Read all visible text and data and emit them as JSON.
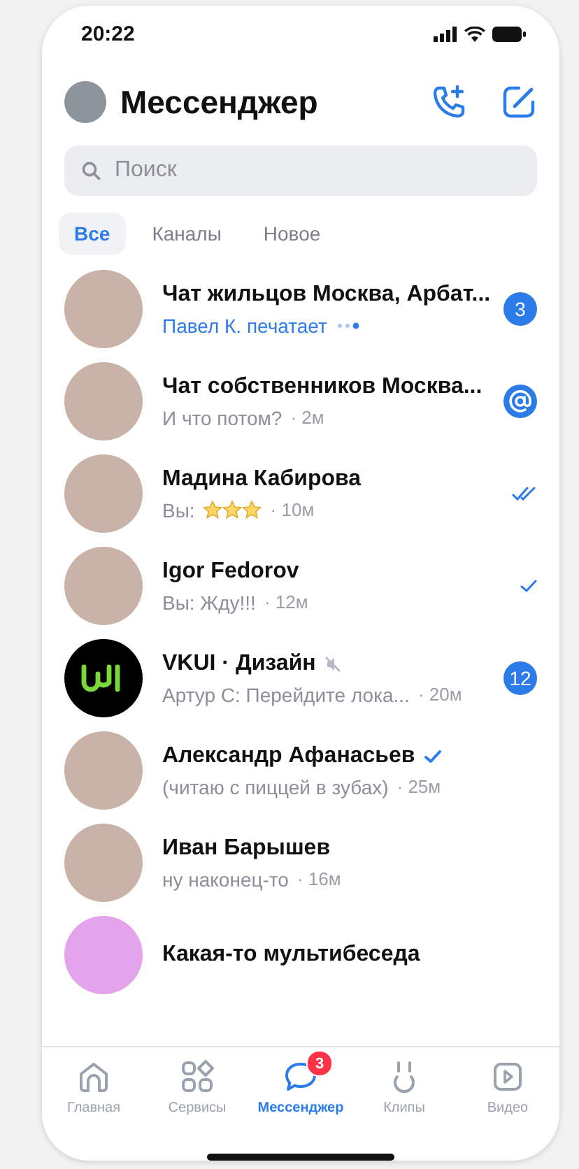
{
  "status_bar": {
    "time": "20:22"
  },
  "header": {
    "title": "Мессенджер"
  },
  "search": {
    "placeholder": "Поиск"
  },
  "filters": [
    {
      "label": "Все",
      "selected": true
    },
    {
      "label": "Каналы",
      "selected": false
    },
    {
      "label": "Новое",
      "selected": false
    }
  ],
  "chats": [
    {
      "avatar": {
        "kind": "photo"
      },
      "title": "Чат жильцов Москва, Арбат...",
      "message": "Павел К. печатает",
      "typing": true,
      "indicator": {
        "kind": "count",
        "unread": "3"
      }
    },
    {
      "avatar": {
        "kind": "photo"
      },
      "title": "Чат собственников Москва...",
      "message": "И что потом?",
      "time": "· 2м",
      "typing": false,
      "indicator": {
        "kind": "mention"
      }
    },
    {
      "avatar": {
        "kind": "photo"
      },
      "title": "Мадина Кабирова",
      "message": "Вы:",
      "stars": 3,
      "time": "· 10м",
      "typing": false,
      "indicator": {
        "kind": "read"
      }
    },
    {
      "avatar": {
        "kind": "photo"
      },
      "title": "Igor Fedorov",
      "message": "Вы: Жду!!!",
      "time": "· 12м",
      "typing": false,
      "indicator": {
        "kind": "sent"
      }
    },
    {
      "avatar": {
        "kind": "logo"
      },
      "title": "VKUI · Дизайн",
      "muted": true,
      "message": "Артур С: Перейдите лока...",
      "time": "· 20м",
      "typing": false,
      "indicator": {
        "kind": "count",
        "unread": "12"
      }
    },
    {
      "avatar": {
        "kind": "photo"
      },
      "title": "Александр Афанасьев",
      "verified": true,
      "message": "(читаю с пиццей в зубах)",
      "time": "· 25м",
      "typing": false
    },
    {
      "avatar": {
        "kind": "photo"
      },
      "title": "Иван Барышев",
      "message": "ну наконец-то",
      "time": "· 16м",
      "typing": false
    },
    {
      "avatar": {
        "kind": "pink"
      },
      "title": "Какая-то мультибеседа",
      "typing": false
    }
  ],
  "tab_bar": [
    {
      "kind": "home",
      "label": "Главная",
      "selected": false
    },
    {
      "kind": "services",
      "label": "Сервисы",
      "selected": false
    },
    {
      "kind": "messenger",
      "label": "Мессенджер",
      "selected": true,
      "badge": "3"
    },
    {
      "kind": "clips",
      "label": "Клипы",
      "selected": false
    },
    {
      "kind": "video",
      "label": "Видео",
      "selected": false
    }
  ]
}
